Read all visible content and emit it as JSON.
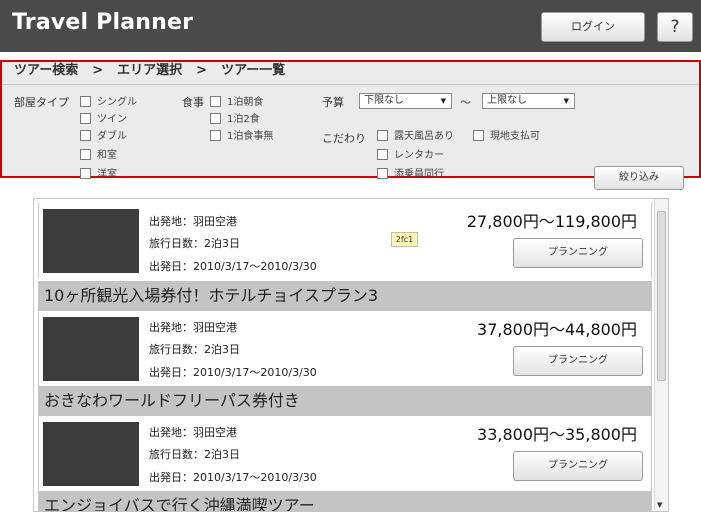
{
  "header": {
    "title": "Travel Planner",
    "login_label": "ログイン",
    "help_label": "?"
  },
  "search": {
    "breadcrumb": [
      "ツアー検索",
      "エリア選択",
      "ツアー一覧"
    ],
    "breadcrumb_separator": ">",
    "room_type_label": "部屋タイプ",
    "room_types": [
      "シングル",
      "ツイン",
      "ダブル",
      "和室",
      "洋室"
    ],
    "meal_label": "食事",
    "meals": [
      "1泊朝食",
      "1泊2食",
      "1泊食事無"
    ],
    "budget_label": "予算",
    "budget_min": "下限なし",
    "budget_tilde": "～",
    "budget_max": "上限なし",
    "preference_label": "こだわり",
    "preferences": [
      "露天風呂あり",
      "現地支払可",
      "レンタカー",
      "添乗員同行"
    ],
    "search_button": "絞り込み"
  },
  "results": {
    "items": [
      {
        "departure": "出発地：羽田空港",
        "duration": "旅行日数：2泊3日",
        "date": "出発日：2010/3/17～2010/3/30",
        "price": "27,800円～119,800円",
        "button": "プランニング"
      },
      {
        "title": "10ヶ所観光入場券付！ホテルチョイスプラン3",
        "departure": "出発地：羽田空港",
        "duration": "旅行日数：2泊3日",
        "date": "出発日：2010/3/17～2010/3/30",
        "price": "37,800円～44,800円",
        "button": "プランニング"
      },
      {
        "title": "おきなわワールドフリーパス券付き",
        "departure": "出発地：羽田空港",
        "duration": "旅行日数：2泊3日",
        "date": "出発日：2010/3/17～2010/3/30",
        "price": "33,800円～35,800円",
        "button": "プランニング"
      }
    ],
    "partial_title": "エンジョイバスで行く沖縄満喫ツアー"
  },
  "tooltip": "2fc1"
}
